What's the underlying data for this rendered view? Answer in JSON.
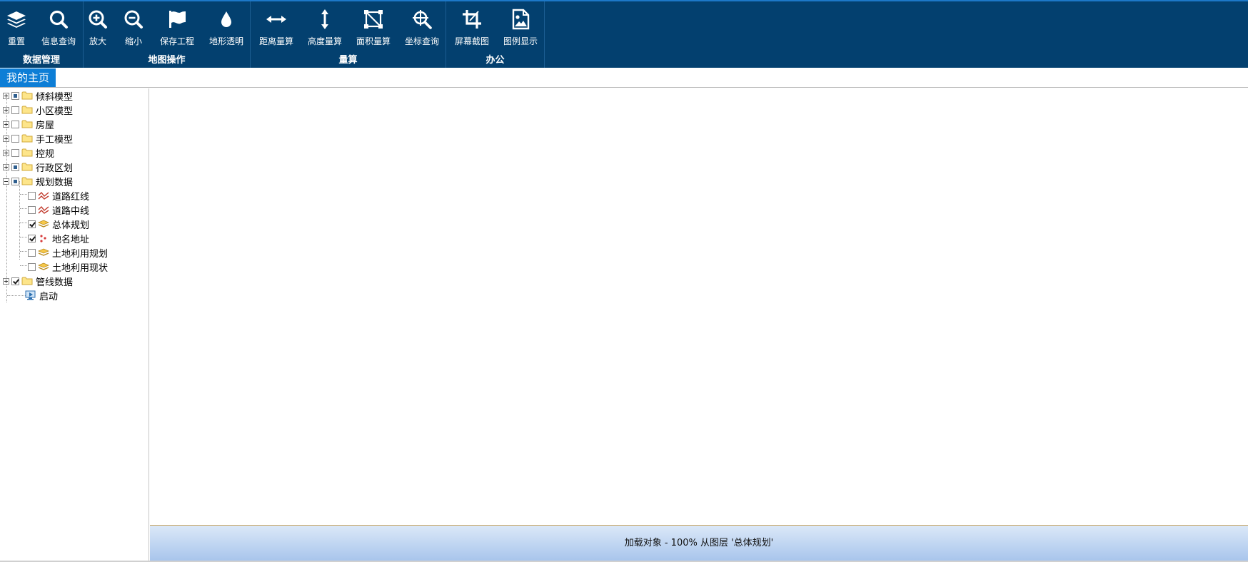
{
  "ribbon": {
    "groups": [
      {
        "title": "数据管理",
        "buttons": [
          {
            "label": "重置",
            "icon": "layers-icon"
          },
          {
            "label": "信息查询",
            "icon": "search-icon"
          }
        ]
      },
      {
        "title": "地图操作",
        "buttons": [
          {
            "label": "放大",
            "icon": "zoom-in-icon"
          },
          {
            "label": "缩小",
            "icon": "zoom-out-icon"
          },
          {
            "label": "保存工程",
            "icon": "flag-icon"
          },
          {
            "label": "地形透明",
            "icon": "drop-icon"
          }
        ]
      },
      {
        "title": "量算",
        "buttons": [
          {
            "label": "距离量算",
            "icon": "horizontal-arrow-icon"
          },
          {
            "label": "高度量算",
            "icon": "vertical-arrow-icon"
          },
          {
            "label": "面积量算",
            "icon": "area-polygon-icon"
          },
          {
            "label": "坐标查询",
            "icon": "crosshair-search-icon"
          }
        ]
      },
      {
        "title": "办公",
        "buttons": [
          {
            "label": "屏幕截图",
            "icon": "crop-icon"
          },
          {
            "label": "图例显示",
            "icon": "image-icon"
          }
        ]
      }
    ]
  },
  "tabs": [
    {
      "label": "我的主页"
    }
  ],
  "tree": [
    {
      "label": "倾斜模型",
      "check": "partial",
      "icon": "folder-icon"
    },
    {
      "label": "小区模型",
      "check": "unchecked",
      "icon": "folder-icon"
    },
    {
      "label": "房屋",
      "check": "unchecked",
      "icon": "folder-icon"
    },
    {
      "label": "手工模型",
      "check": "unchecked",
      "icon": "folder-icon"
    },
    {
      "label": "控规",
      "check": "unchecked",
      "icon": "folder-icon"
    },
    {
      "label": "行政区划",
      "check": "partial",
      "icon": "folder-icon"
    },
    {
      "label": "规划数据",
      "check": "partial",
      "icon": "folder-icon",
      "expanded": true,
      "children": [
        {
          "label": "道路红线",
          "check": "unchecked",
          "icon": "polyline-layer-icon"
        },
        {
          "label": "道路中线",
          "check": "unchecked",
          "icon": "polyline-layer-icon"
        },
        {
          "label": "总体规划",
          "check": "checked",
          "icon": "polygon-layer-icon"
        },
        {
          "label": "地名地址",
          "check": "checked",
          "icon": "point-layer-icon"
        },
        {
          "label": "土地利用规划",
          "check": "unchecked",
          "icon": "polygon-layer-icon"
        },
        {
          "label": "土地利用现状",
          "check": "unchecked",
          "icon": "polygon-layer-icon"
        }
      ]
    },
    {
      "label": "管线数据",
      "check": "checked",
      "icon": "folder-icon"
    },
    {
      "label": "启动",
      "check": "none",
      "icon": "monitor-icon"
    }
  ],
  "status": {
    "text": "加载对象 - 100% 从图层 '总体规划'"
  },
  "colors": {
    "ribbon_bg": "#03406f",
    "tab_active": "#0d7ed6",
    "status_gradient": "#a8c5ec"
  }
}
